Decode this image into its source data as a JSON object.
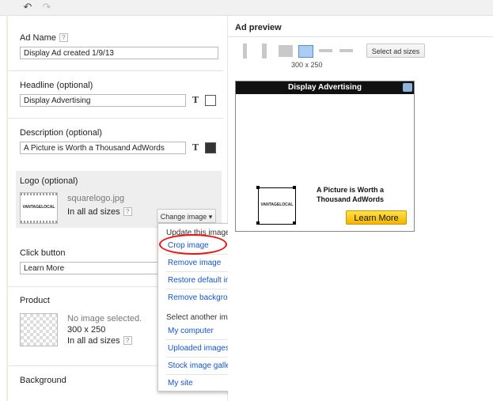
{
  "toolbar": {
    "undo_icon": "undo-icon",
    "redo_icon": "redo-icon"
  },
  "editor": {
    "ad_name": {
      "label": "Ad Name",
      "help": "?",
      "value": "Display Ad created 1/9/13"
    },
    "headline": {
      "label": "Headline  (optional)",
      "value": "Display Advertising",
      "text_glyph": "T",
      "color": "#ffffff"
    },
    "description": {
      "label": "Description  (optional)",
      "value": "A Picture is Worth a Thousand AdWords",
      "text_glyph": "T",
      "color": "#333333"
    },
    "logo": {
      "label": "Logo  (optional)",
      "thumb_text": "VANTAGELOCAL",
      "filename": "squarelogo.jpg",
      "sizes_text": "In all ad sizes",
      "help": "?",
      "change_button": "Change image",
      "change_arrow": "▾"
    },
    "click_button": {
      "label": "Click button",
      "value": "Learn More"
    },
    "product": {
      "label": "Product",
      "no_image": "No image selected.",
      "size": "300 x 250",
      "sizes_text": "In all ad sizes",
      "help": "?"
    },
    "background": {
      "label": "Background"
    }
  },
  "menu": {
    "header_update": "Update this image:",
    "crop": "Crop image",
    "remove": "Remove image",
    "restore": "Restore default image",
    "remove_bg": "Remove background",
    "header_select": "Select another image:",
    "my_computer": "My computer",
    "uploaded": "Uploaded images",
    "stock": "Stock image gallery",
    "my_site": "My site"
  },
  "preview": {
    "title": "Ad preview",
    "selected_size_label": "300 x 250",
    "select_sizes_button": "Select ad sizes",
    "ad": {
      "headline": "Display Advertising",
      "logo_text": "VANTAGELOCAL",
      "description": "A Picture is Worth a Thousand AdWords",
      "button": "Learn More",
      "button_color": "#f5b400",
      "header_color": "#111111"
    }
  },
  "colors": {
    "accent_link": "#1155cc",
    "highlight_circle": "#ee1111",
    "selected_size": "#a9cdf5"
  }
}
